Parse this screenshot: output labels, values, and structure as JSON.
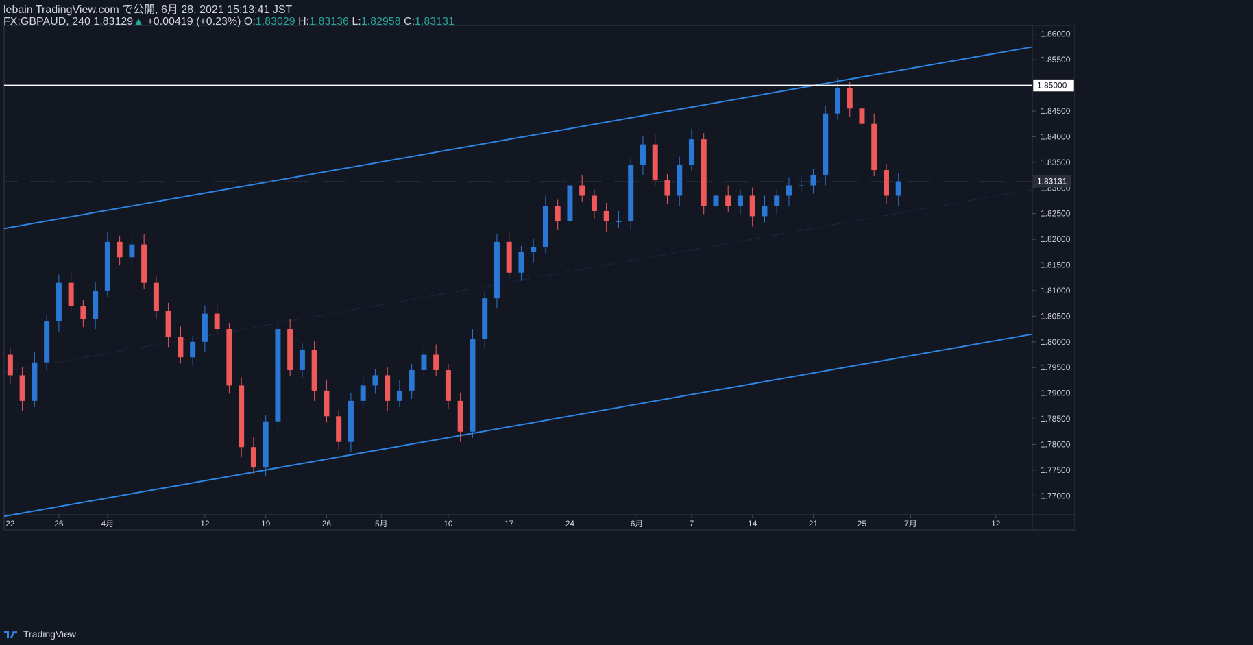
{
  "header": {
    "line1": "lebain TradingView.com で公開, 6月 28, 2021 15:13:41 JST",
    "symbol": "FX:GBPAUD, 240",
    "last": "1.83129",
    "change_arrow": "▲",
    "change": "+0.00419 (+0.23%)",
    "o_label": "O:",
    "o": "1.83029",
    "h_label": "H:",
    "h": "1.83136",
    "l_label": "L:",
    "l": "1.82958",
    "c_label": "C:",
    "c": "1.83131"
  },
  "footer": {
    "brand": "TradingView"
  },
  "colors": {
    "background": "#131722",
    "up": "#2a77d6",
    "down": "#f0595a",
    "channel": "#2d86e6",
    "hline": "#ffffff",
    "text": "#d1d4dc",
    "green": "#26a69a"
  },
  "chart_data": {
    "type": "candlestick",
    "symbol": "FX:GBPAUD",
    "timeframe": "240",
    "y_ticks": [
      1.86,
      1.855,
      1.85,
      1.845,
      1.84,
      1.835,
      1.83,
      1.825,
      1.82,
      1.815,
      1.81,
      1.805,
      1.8,
      1.795,
      1.79,
      1.785,
      1.78,
      1.775,
      1.77
    ],
    "y_tick_labels": [
      "1.86000",
      "1.85500",
      "1.85000",
      "1.84500",
      "1.84000",
      "1.83500",
      "1.83000",
      "1.82500",
      "1.82000",
      "1.81500",
      "1.81000",
      "1.80500",
      "1.80000",
      "1.79500",
      "1.79000",
      "1.78500",
      "1.78000",
      "1.77500",
      "1.77000"
    ],
    "ylim": [
      1.7663,
      1.8617
    ],
    "x_ticks": [
      {
        "label": "22",
        "t": 0.5
      },
      {
        "label": "26",
        "t": 4.5
      },
      {
        "label": "4月",
        "t": 8.5
      },
      {
        "label": "12",
        "t": 16.5
      },
      {
        "label": "19",
        "t": 21.5
      },
      {
        "label": "26",
        "t": 26.5
      },
      {
        "label": "5月",
        "t": 31
      },
      {
        "label": "10",
        "t": 36.5
      },
      {
        "label": "17",
        "t": 41.5
      },
      {
        "label": "24",
        "t": 46.5
      },
      {
        "label": "6月",
        "t": 52
      },
      {
        "label": "7",
        "t": 56.5
      },
      {
        "label": "14",
        "t": 61.5
      },
      {
        "label": "21",
        "t": 66.5
      },
      {
        "label": "25",
        "t": 70.5
      },
      {
        "label": "7月",
        "t": 74.5
      },
      {
        "label": "12",
        "t": 81.5
      }
    ],
    "xlim": [
      0,
      84.5
    ],
    "horizontal_line": {
      "price": 1.85,
      "label": "1.85000"
    },
    "last_price": {
      "price": 1.83131,
      "label": "1.83131"
    },
    "channel": {
      "upper": [
        {
          "t": 0,
          "p": 1.8221
        },
        {
          "t": 84.5,
          "p": 1.8575
        }
      ],
      "lower": [
        {
          "t": 0,
          "p": 1.766
        },
        {
          "t": 84.5,
          "p": 1.8015
        }
      ],
      "mid": [
        {
          "t": 0,
          "p": 1.7942
        },
        {
          "t": 84.5,
          "p": 1.8297
        }
      ]
    },
    "closes": [
      1.7935,
      1.7885,
      1.796,
      1.804,
      1.8115,
      1.807,
      1.8045,
      1.81,
      1.8195,
      1.8165,
      1.819,
      1.8115,
      1.806,
      1.801,
      1.797,
      1.8,
      1.8055,
      1.8025,
      1.7915,
      1.7795,
      1.7755,
      1.7845,
      1.8025,
      1.7945,
      1.7985,
      1.7905,
      1.7855,
      1.7805,
      1.7885,
      1.7915,
      1.7935,
      1.7885,
      1.7905,
      1.7945,
      1.7975,
      1.7945,
      1.7885,
      1.7825,
      1.8005,
      1.8085,
      1.8195,
      1.8135,
      1.8175,
      1.8185,
      1.8265,
      1.8235,
      1.8305,
      1.8285,
      1.8255,
      1.8235,
      1.8235,
      1.8345,
      1.8385,
      1.8315,
      1.8285,
      1.8345,
      1.8395,
      1.8265,
      1.8285,
      1.8265,
      1.8285,
      1.8245,
      1.8265,
      1.8285,
      1.8305,
      1.8305,
      1.8325,
      1.8445,
      1.8495,
      1.8455,
      1.8425,
      1.8335,
      1.8285,
      1.8313
    ]
  }
}
